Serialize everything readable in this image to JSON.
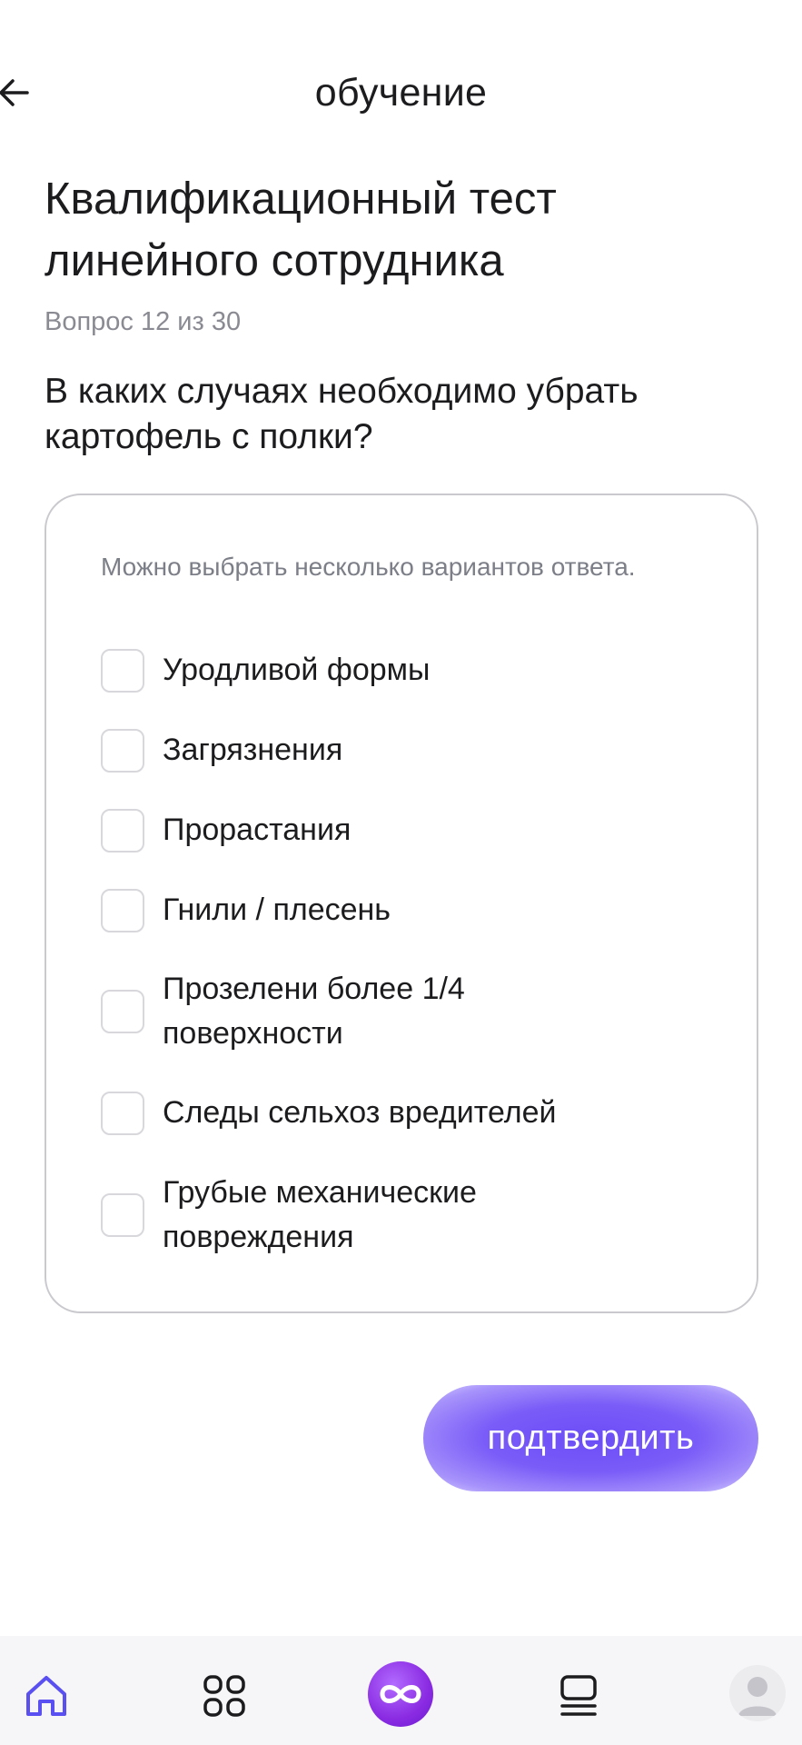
{
  "header": {
    "title": "обучение"
  },
  "test": {
    "title": "Квалификационный тест линейного сотрудника",
    "counter": "Вопрос 12 из 30",
    "question": "В каких случаях необходимо убрать картофель с полки?"
  },
  "answers": {
    "hint": "Можно выбрать несколько вариантов ответа.",
    "options": [
      "Уродливой формы",
      "Загрязнения",
      "Прорастания",
      "Гнили / плесень",
      "Прозелени более 1/4 поверхности",
      "Следы сельхоз вредителей",
      "Грубые механические повреждения"
    ]
  },
  "confirm": {
    "label": "подтвердить"
  },
  "colors": {
    "accent": "#6b4df7",
    "nav_icon": "#5a4ff0",
    "center_button": "#8a2be2"
  },
  "icons": {
    "back": "arrow-left-icon",
    "home": "home-icon",
    "catalog": "grid-icon",
    "center": "infinity-icon",
    "courses": "courses-icon",
    "profile": "avatar-icon"
  }
}
